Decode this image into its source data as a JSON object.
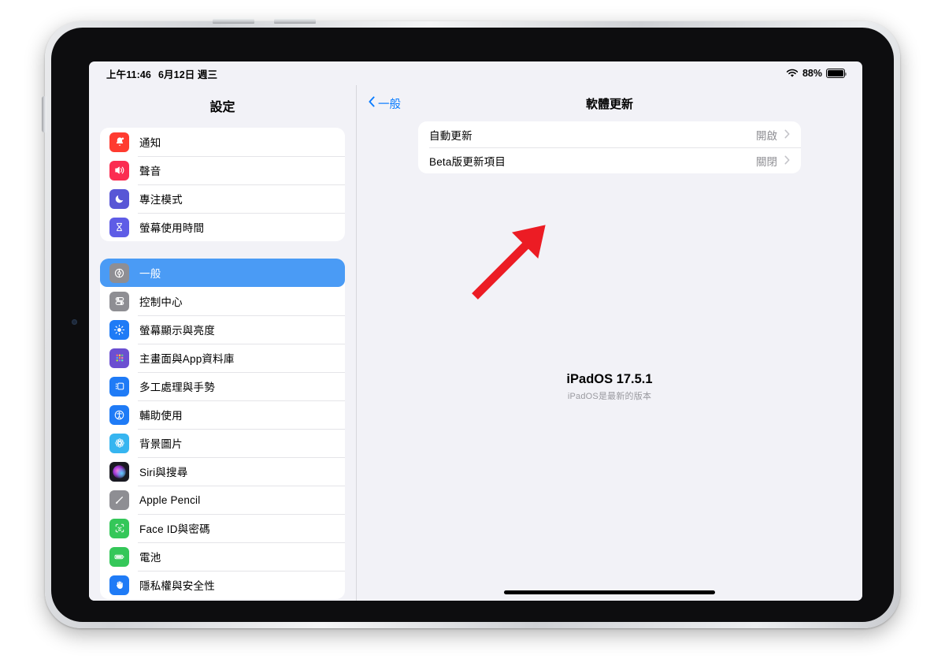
{
  "status_bar": {
    "time": "上午11:46",
    "date": "6月12日 週三",
    "wifi_icon": "wifi-icon",
    "battery_percent": "88%",
    "battery_icon": "battery-icon"
  },
  "sidebar": {
    "title": "設定",
    "groups": [
      {
        "items": [
          {
            "label": "通知",
            "icon": "bell-icon",
            "color": "#ff3b30",
            "selected": false
          },
          {
            "label": "聲音",
            "icon": "speaker-icon",
            "color": "#fb2c51",
            "selected": false
          },
          {
            "label": "專注模式",
            "icon": "moon-icon",
            "color": "#5856d6",
            "selected": false
          },
          {
            "label": "螢幕使用時間",
            "icon": "hourglass-icon",
            "color": "#5e5ce6",
            "selected": false
          }
        ]
      },
      {
        "items": [
          {
            "label": "一般",
            "icon": "gear-icon",
            "color": "#8e8e93",
            "selected": true
          },
          {
            "label": "控制中心",
            "icon": "control-center-icon",
            "color": "#8e8e93",
            "selected": false
          },
          {
            "label": "螢幕顯示與亮度",
            "icon": "brightness-icon",
            "color": "#1f7bf6",
            "selected": false
          },
          {
            "label": "主畫面與App資料庫",
            "icon": "app-library-icon",
            "color": "#6b4fd1",
            "selected": false
          },
          {
            "label": "多工處理與手勢",
            "icon": "multitasking-icon",
            "color": "#1f7bf6",
            "selected": false
          },
          {
            "label": "輔助使用",
            "icon": "accessibility-icon",
            "color": "#1f7bf6",
            "selected": false
          },
          {
            "label": "背景圖片",
            "icon": "wallpaper-icon",
            "color": "#36b5f0",
            "selected": false
          },
          {
            "label": "Siri與搜尋",
            "icon": "siri-icon",
            "color": "#2b2b33",
            "selected": false
          },
          {
            "label": "Apple Pencil",
            "icon": "pencil-icon",
            "color": "#8e8e93",
            "selected": false
          },
          {
            "label": "Face ID與密碼",
            "icon": "faceid-icon",
            "color": "#34c759",
            "selected": false
          },
          {
            "label": "電池",
            "icon": "battery-settings-icon",
            "color": "#34c759",
            "selected": false
          },
          {
            "label": "隱私權與安全性",
            "icon": "hand-icon",
            "color": "#1f7bf6",
            "selected": false
          }
        ]
      }
    ]
  },
  "detail": {
    "back_label": "一般",
    "back_icon": "chevron-left-icon",
    "title": "軟體更新",
    "rows": [
      {
        "label": "自動更新",
        "value": "開啟",
        "chevron": "chevron-right-icon"
      },
      {
        "label": "Beta版更新項目",
        "value": "關閉",
        "chevron": "chevron-right-icon"
      }
    ],
    "version_title": "iPadOS 17.5.1",
    "version_subtitle": "iPadOS是最新的版本"
  },
  "annotation": {
    "arrow_color": "#ec1c24",
    "target": "Beta版更新項目"
  }
}
